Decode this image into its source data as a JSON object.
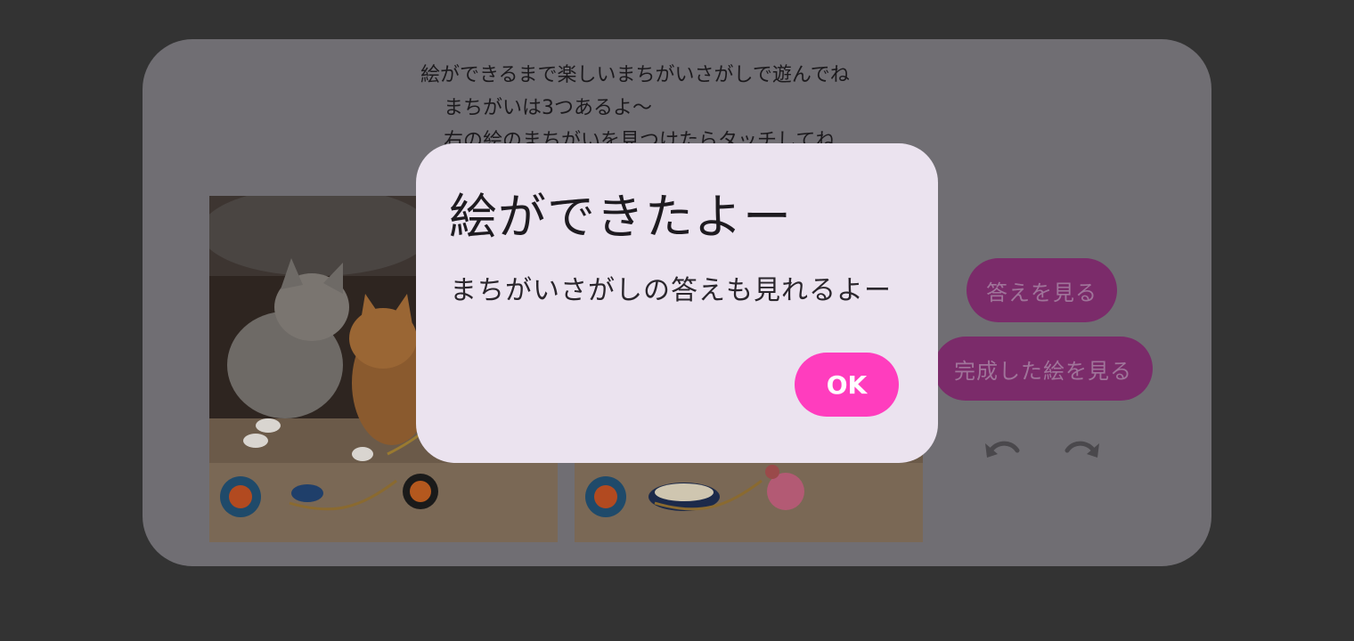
{
  "instructions": {
    "line1": "絵ができるまで楽しいまちがいさがしで遊んでね",
    "line2": "まちがいは3つあるよ〜",
    "line3": "右の絵のまちがいを見つけたらタッチしてね"
  },
  "images": {
    "left_alt": "cats playing with toys",
    "right_alt": "cats playing with toys (with differences)"
  },
  "buttons": {
    "show_answer": "答えを見る",
    "show_completed": "完成した絵を見る"
  },
  "dialog": {
    "title": "絵ができたよー",
    "message": "まちがいさがしの答えも見れるよー",
    "ok": "OK"
  },
  "colors": {
    "accent": "#ff3dbe",
    "dialog_bg": "#ebe3ef",
    "overlay": "#706e73"
  },
  "icons": {
    "undo": "undo-icon",
    "redo": "redo-icon"
  }
}
